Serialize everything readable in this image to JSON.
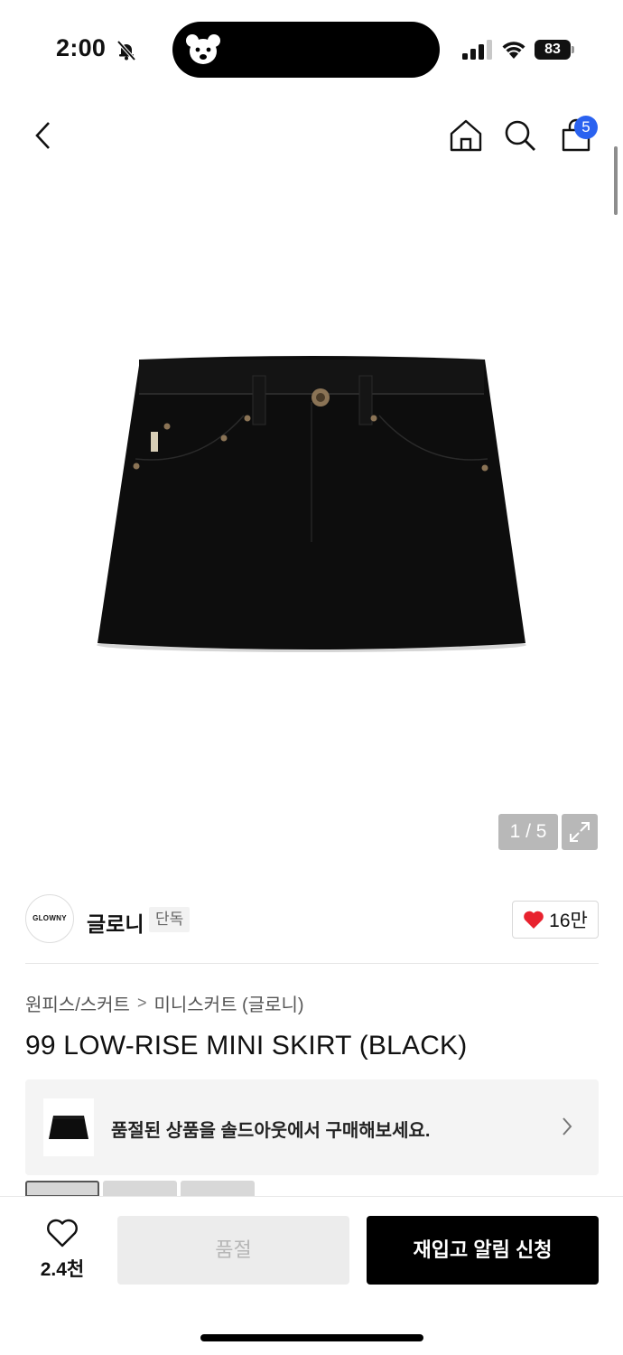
{
  "status_bar": {
    "time": "2:00",
    "battery": "83",
    "icons": [
      "bell-off-icon",
      "signal-icon",
      "wifi-icon",
      "battery-icon"
    ]
  },
  "nav": {
    "icons": [
      "back-icon",
      "home-icon",
      "search-icon",
      "bag-icon"
    ],
    "cart_count": "5"
  },
  "gallery": {
    "pager": "1 / 5",
    "expand_icon": "expand-icon"
  },
  "brand": {
    "logo_text": "GLOWNY",
    "name": "글로니",
    "tag": "단독",
    "like_count": "16만"
  },
  "breadcrumb": {
    "category": "원피스/스커트",
    "separator": ">",
    "subcategory": "미니스커트 (글로니)"
  },
  "product": {
    "title": "99 LOW-RISE MINI SKIRT (BLACK)"
  },
  "soldout_banner": {
    "text": "품절된 상품을 솔드아웃에서 구매해보세요."
  },
  "bottom_bar": {
    "wish_count": "2.4천",
    "soldout_label": "품절",
    "restock_label": "재입고 알림 신청"
  },
  "colors": {
    "accent_blue": "#2a62f0",
    "heart_red": "#e8222e",
    "primary_button": "#000000",
    "disabled_button": "#ececec"
  }
}
